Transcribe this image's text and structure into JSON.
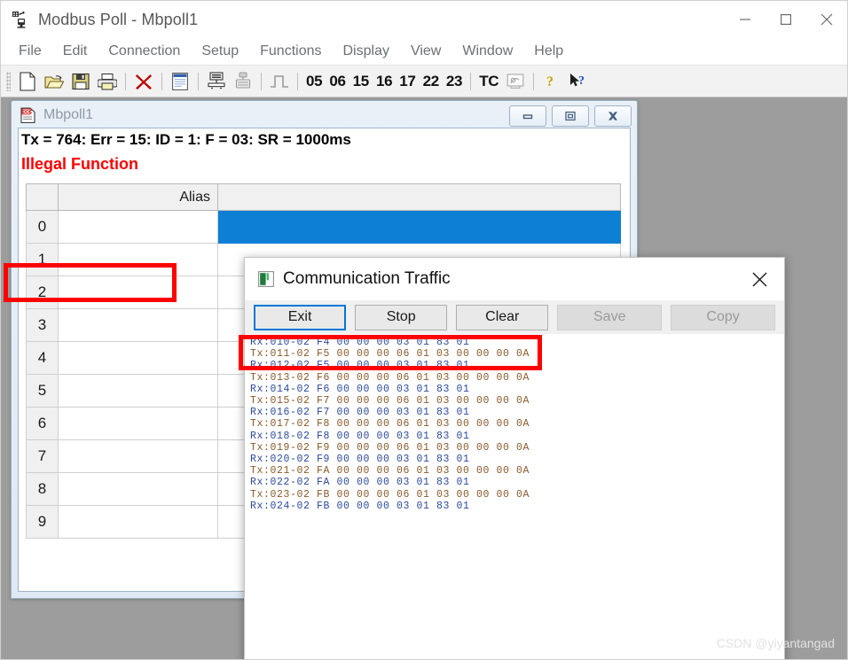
{
  "window": {
    "title": "Modbus Poll - Mbpoll1",
    "app_icon": "modbus-poll-icon",
    "controls": {
      "minimize": "minimize-icon",
      "maximize": "maximize-icon",
      "close": "close-icon"
    }
  },
  "menubar": {
    "items": [
      {
        "label": "File"
      },
      {
        "label": "Edit"
      },
      {
        "label": "Connection"
      },
      {
        "label": "Setup"
      },
      {
        "label": "Functions"
      },
      {
        "label": "Display"
      },
      {
        "label": "View"
      },
      {
        "label": "Window"
      },
      {
        "label": "Help"
      }
    ]
  },
  "toolbar": {
    "icons": [
      {
        "name": "new-file-icon"
      },
      {
        "name": "open-folder-icon"
      },
      {
        "name": "save-icon"
      },
      {
        "name": "print-icon"
      },
      {
        "name": "delete-icon"
      },
      {
        "name": "window-icon"
      },
      {
        "name": "read-write-definition-icon"
      },
      {
        "name": "poll-definition-icon"
      },
      {
        "name": "pulse-icon"
      }
    ],
    "function_codes": [
      "05",
      "06",
      "15",
      "16",
      "17",
      "22",
      "23"
    ],
    "tc_label": "TC",
    "tc_icon": "communication-traffic-icon",
    "help_icon": "help-icon",
    "context_help_icon": "context-help-icon"
  },
  "mdi_child": {
    "title": "Mbpoll1",
    "icon": "document-icon",
    "controls": {
      "restore": "restore-icon",
      "maximize": "maximize-icon",
      "close": "close-icon"
    },
    "status_line": "Tx = 764: Err = 15: ID = 1: F = 03: SR = 1000ms",
    "error_line": "Illegal Function",
    "grid": {
      "headers": [
        "",
        "Alias",
        ""
      ],
      "rows": [
        {
          "index": "0",
          "alias": "",
          "value": "",
          "selected": true
        },
        {
          "index": "1",
          "alias": "",
          "value": "",
          "selected": false
        },
        {
          "index": "2",
          "alias": "",
          "value": "",
          "selected": false
        },
        {
          "index": "3",
          "alias": "",
          "value": "",
          "selected": false
        },
        {
          "index": "4",
          "alias": "",
          "value": "",
          "selected": false
        },
        {
          "index": "5",
          "alias": "",
          "value": "",
          "selected": false
        },
        {
          "index": "6",
          "alias": "",
          "value": "",
          "selected": false
        },
        {
          "index": "7",
          "alias": "",
          "value": "",
          "selected": false
        },
        {
          "index": "8",
          "alias": "",
          "value": "",
          "selected": false
        },
        {
          "index": "9",
          "alias": "",
          "value": "",
          "selected": false
        }
      ]
    }
  },
  "dialog": {
    "title": "Communication Traffic",
    "icon": "traffic-monitor-icon",
    "close_icon": "close-icon",
    "buttons": [
      {
        "label": "Exit",
        "state": "default"
      },
      {
        "label": "Stop",
        "state": "enabled"
      },
      {
        "label": "Clear",
        "state": "enabled"
      },
      {
        "label": "Save",
        "state": "disabled"
      },
      {
        "label": "Copy",
        "state": "disabled"
      }
    ],
    "log_lines": [
      {
        "dir": "rx",
        "text": "Rx:010-02 F4 00 00 00 03 01 83 01"
      },
      {
        "dir": "tx",
        "text": "Tx:011-02 F5 00 00 00 06 01 03 00 00 00 0A"
      },
      {
        "dir": "rx",
        "text": "Rx:012-02 F5 00 00 00 03 01 83 01"
      },
      {
        "dir": "tx",
        "text": "Tx:013-02 F6 00 00 00 06 01 03 00 00 00 0A"
      },
      {
        "dir": "rx",
        "text": "Rx:014-02 F6 00 00 00 03 01 83 01"
      },
      {
        "dir": "tx",
        "text": "Tx:015-02 F7 00 00 00 06 01 03 00 00 00 0A"
      },
      {
        "dir": "rx",
        "text": "Rx:016-02 F7 00 00 00 03 01 83 01"
      },
      {
        "dir": "tx",
        "text": "Tx:017-02 F8 00 00 00 06 01 03 00 00 00 0A"
      },
      {
        "dir": "rx",
        "text": "Rx:018-02 F8 00 00 00 03 01 83 01"
      },
      {
        "dir": "tx",
        "text": "Tx:019-02 F9 00 00 00 06 01 03 00 00 00 0A"
      },
      {
        "dir": "rx",
        "text": "Rx:020-02 F9 00 00 00 03 01 83 01"
      },
      {
        "dir": "tx",
        "text": "Tx:021-02 FA 00 00 00 06 01 03 00 00 00 0A"
      },
      {
        "dir": "rx",
        "text": "Rx:022-02 FA 00 00 00 03 01 83 01"
      },
      {
        "dir": "tx",
        "text": "Tx:023-02 FB 00 00 00 06 01 03 00 00 00 0A"
      },
      {
        "dir": "rx",
        "text": "Rx:024-02 FB 00 00 00 03 01 83 01"
      }
    ]
  },
  "annotations": [
    {
      "name": "illegal-function-highlight",
      "color": "#fe0000"
    },
    {
      "name": "log-lines-highlight",
      "color": "#fe0000"
    }
  ],
  "watermark": {
    "text": "CSDN @yiyantangad"
  },
  "colors": {
    "accent_blue": "#0d7fd4",
    "annotation_red": "#fe0000",
    "error_red": "#ff0000",
    "workspace_gray": "#9d9d9d"
  }
}
